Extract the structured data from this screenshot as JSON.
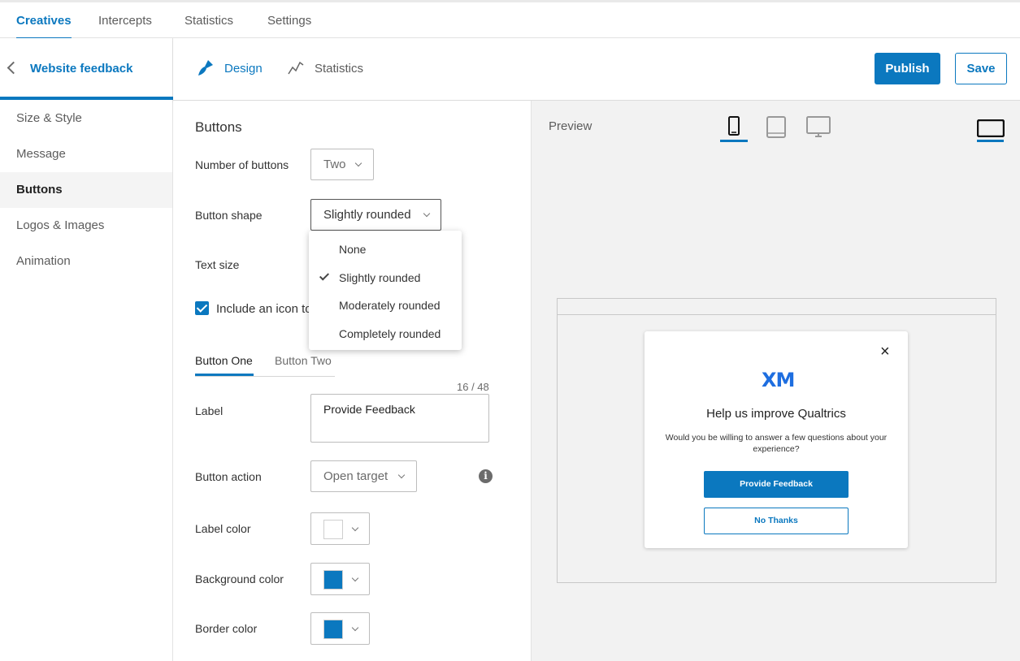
{
  "topnav": {
    "tabs": [
      "Creatives",
      "Intercepts",
      "Statistics",
      "Settings"
    ],
    "active": "Creatives"
  },
  "sidebar": {
    "back_title": "Website feedback",
    "items": [
      "Size & Style",
      "Message",
      "Buttons",
      "Logos & Images",
      "Animation"
    ],
    "active": "Buttons"
  },
  "subheader": {
    "tabs": [
      "Design",
      "Statistics"
    ],
    "publish_label": "Publish",
    "save_label": "Save"
  },
  "panel": {
    "heading": "Buttons",
    "number_of_buttons_label": "Number of buttons",
    "number_of_buttons_value": "Two",
    "button_shape_label": "Button shape",
    "button_shape_value": "Slightly rounded",
    "text_size_label": "Text size",
    "include_icon_label": "Include an icon to",
    "include_icon_checked": true,
    "subtabs": [
      "Button One",
      "Button Two"
    ],
    "char_counter": "16 / 48",
    "label_label": "Label",
    "label_value": "Provide Feedback",
    "button_action_label": "Button action",
    "button_action_value": "Open target",
    "label_color_label": "Label color",
    "label_color": "#ffffff",
    "background_color_label": "Background color",
    "background_color": "#0b78bf",
    "border_color_label": "Border color",
    "border_color": "#0b78bf"
  },
  "shape_menu": {
    "options": [
      "None",
      "Slightly rounded",
      "Moderately rounded",
      "Completely rounded"
    ],
    "selected": "Slightly rounded"
  },
  "preview": {
    "label": "Preview",
    "devices": [
      "phone-icon",
      "tablet-icon",
      "desktop-icon",
      "laptop-icon"
    ],
    "card": {
      "logo": "XM",
      "title": "Help us improve Qualtrics",
      "description": "Would you be willing to answer a few questions about your experience?",
      "primary_button": "Provide Feedback",
      "secondary_button": "No Thanks",
      "close": "×"
    }
  },
  "colors": {
    "accent": "#0b78bf",
    "logo": "#1e6ee0"
  }
}
